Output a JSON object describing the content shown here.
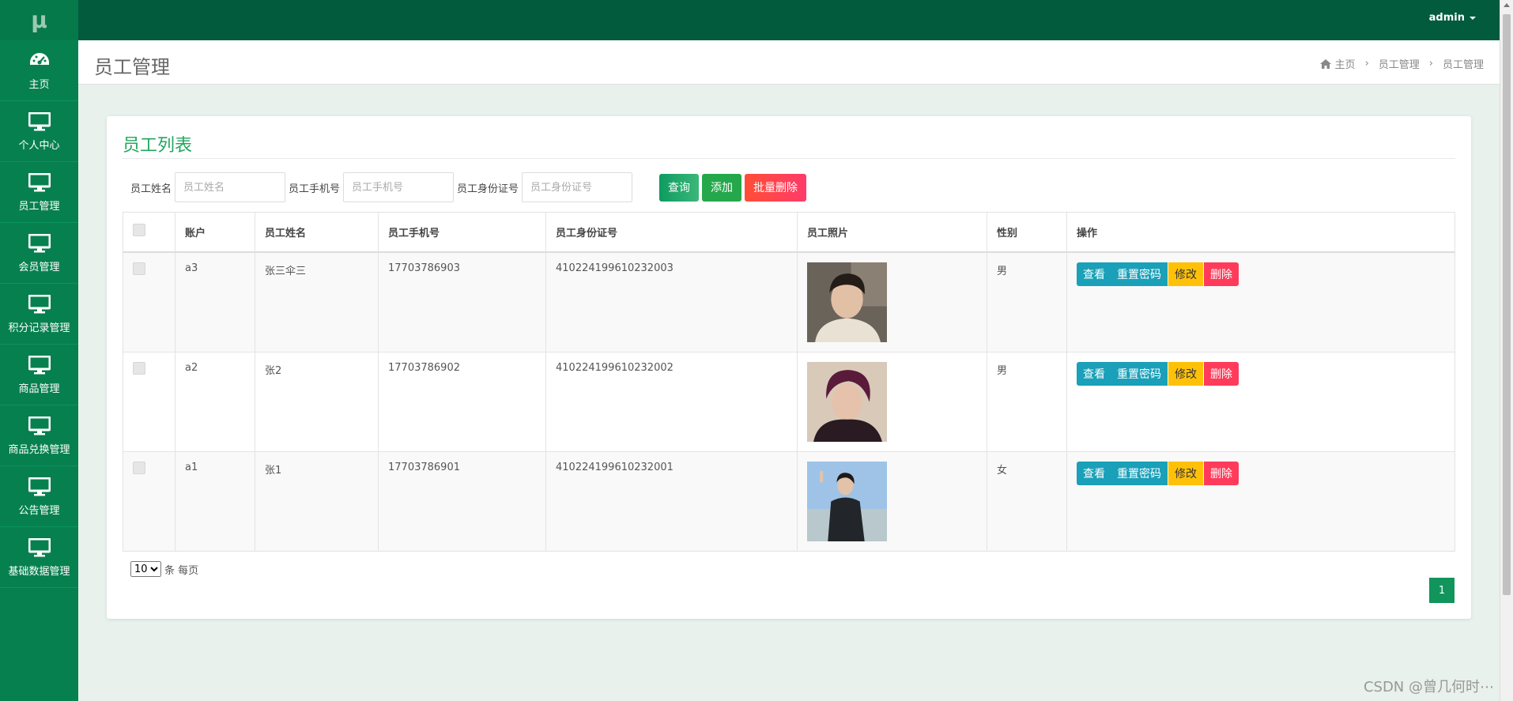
{
  "logo": "μ",
  "sidebar": {
    "items": [
      {
        "label": "主页",
        "icon": "dashboard-icon"
      },
      {
        "label": "个人中心",
        "icon": "monitor-icon"
      },
      {
        "label": "员工管理",
        "icon": "monitor-icon"
      },
      {
        "label": "会员管理",
        "icon": "monitor-icon"
      },
      {
        "label": "积分记录管理",
        "icon": "monitor-icon"
      },
      {
        "label": "商品管理",
        "icon": "monitor-icon"
      },
      {
        "label": "商品兑换管理",
        "icon": "monitor-icon"
      },
      {
        "label": "公告管理",
        "icon": "monitor-icon"
      },
      {
        "label": "基础数据管理",
        "icon": "monitor-icon"
      }
    ]
  },
  "topbar": {
    "user": "admin"
  },
  "header": {
    "title": "员工管理",
    "breadcrumb": [
      "主页",
      "员工管理",
      "员工管理"
    ]
  },
  "card": {
    "title": "员工列表"
  },
  "filters": {
    "name_label": "员工姓名",
    "name_placeholder": "员工姓名",
    "phone_label": "员工手机号",
    "phone_placeholder": "员工手机号",
    "id_label": "员工身份证号",
    "id_placeholder": "员工身份证号",
    "query": "查询",
    "add": "添加",
    "bulk_delete": "批量删除"
  },
  "table": {
    "columns": [
      "账户",
      "员工姓名",
      "员工手机号",
      "员工身份证号",
      "员工照片",
      "性别",
      "操作"
    ],
    "rows": [
      {
        "account": "a3",
        "name": "张三伞三",
        "phone": "17703786903",
        "idno": "410224199610232003",
        "gender": "男"
      },
      {
        "account": "a2",
        "name": "张2",
        "phone": "17703786902",
        "idno": "410224199610232002",
        "gender": "男"
      },
      {
        "account": "a1",
        "name": "张1",
        "phone": "17703786901",
        "idno": "410224199610232001",
        "gender": "女"
      }
    ],
    "actions": {
      "view": "查看",
      "reset": "重置密码",
      "edit": "修改",
      "delete": "删除"
    }
  },
  "pager": {
    "page_size": "10",
    "per_page_text": "条 每页",
    "current_page": "1"
  },
  "watermark": "CSDN @曾几何时⋯",
  "colors": {
    "sidebar": "#07804f",
    "topbar": "#015b3c",
    "accent": "#22a65e"
  }
}
